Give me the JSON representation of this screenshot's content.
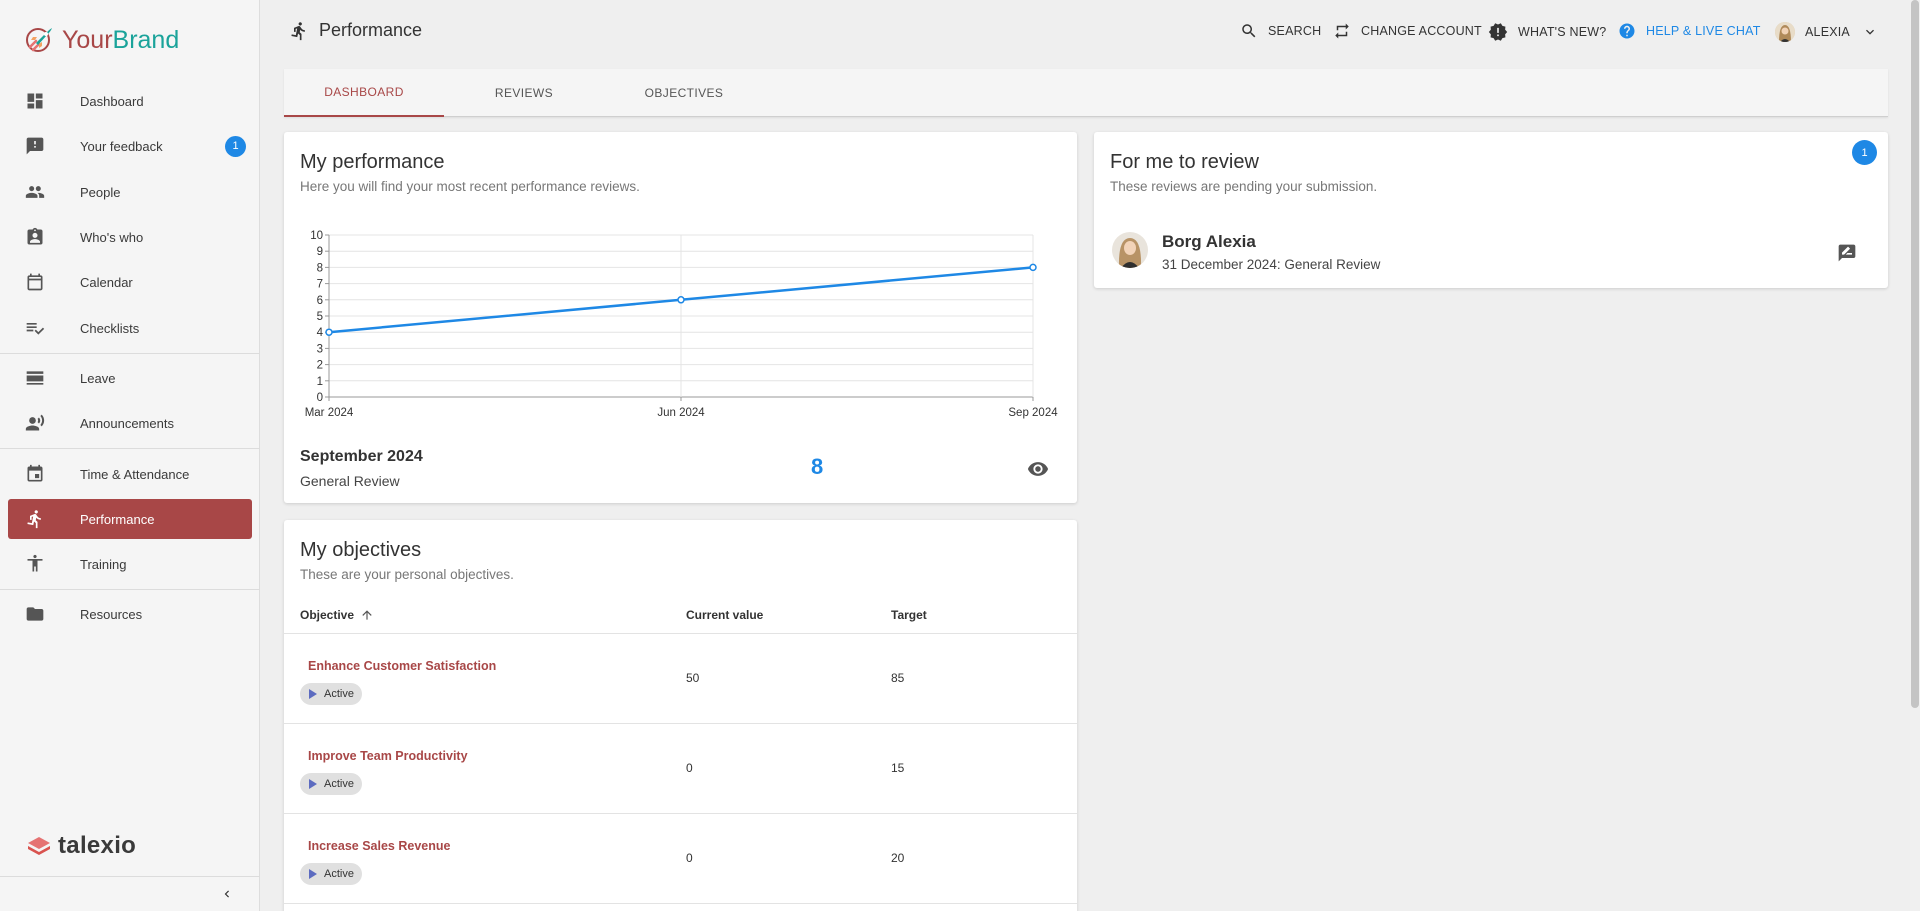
{
  "brand": {
    "your": "Your",
    "brand": "Brand",
    "footer_logo": "talexio"
  },
  "sidebar": {
    "items": [
      {
        "label": "Dashboard",
        "icon": "dashboard-icon"
      },
      {
        "label": "Your feedback",
        "icon": "feedback-icon",
        "badge": "1"
      },
      {
        "label": "People",
        "icon": "people-icon"
      },
      {
        "label": "Who's who",
        "icon": "contact-card-icon"
      },
      {
        "label": "Calendar",
        "icon": "calendar-icon"
      },
      {
        "label": "Checklists",
        "icon": "checklist-icon"
      },
      {
        "label": "Leave",
        "icon": "leave-icon"
      },
      {
        "label": "Announcements",
        "icon": "announcement-icon"
      },
      {
        "label": "Time & Attendance",
        "icon": "event-icon"
      },
      {
        "label": "Performance",
        "icon": "run-icon",
        "active": true
      },
      {
        "label": "Training",
        "icon": "training-icon"
      },
      {
        "label": "Resources",
        "icon": "folder-icon"
      }
    ]
  },
  "header": {
    "title": "Performance",
    "search": "SEARCH",
    "change_account": "CHANGE ACCOUNT",
    "whats_new": "WHAT'S NEW?",
    "help": "HELP & LIVE CHAT",
    "user": "ALEXIA"
  },
  "tabs": [
    "DASHBOARD",
    "REVIEWS",
    "OBJECTIVES"
  ],
  "performance": {
    "title": "My performance",
    "subtitle": "Here you will find your most recent performance reviews.",
    "latest_month": "September 2024",
    "latest_type": "General Review",
    "latest_score": "8"
  },
  "chart_data": {
    "type": "line",
    "x": [
      "Mar 2024",
      "Jun 2024",
      "Sep 2024"
    ],
    "series": [
      {
        "values": [
          4,
          6,
          8
        ]
      }
    ],
    "ylim": [
      0,
      10
    ],
    "yticks": [
      "0",
      "1",
      "2",
      "3",
      "4",
      "5",
      "6",
      "7",
      "8",
      "9",
      "10"
    ],
    "grid": true,
    "color": "#1e88e5"
  },
  "objectives": {
    "title": "My objectives",
    "subtitle": "These are your personal objectives.",
    "columns": [
      "Objective",
      "Current value",
      "Target"
    ],
    "rows": [
      {
        "name": "Enhance Customer Satisfaction",
        "status": "Active",
        "current": "50",
        "target": "85"
      },
      {
        "name": "Improve Team Productivity",
        "status": "Active",
        "current": "0",
        "target": "15"
      },
      {
        "name": "Increase Sales Revenue",
        "status": "Active",
        "current": "0",
        "target": "20"
      }
    ]
  },
  "review": {
    "title": "For me to review",
    "subtitle": "These reviews are pending your submission.",
    "badge": "1",
    "name": "Borg Alexia",
    "detail": "31 December 2024: General Review"
  },
  "colors": {
    "accent": "#a84747",
    "primary": "#1e88e5",
    "teal": "#1aa39a"
  }
}
